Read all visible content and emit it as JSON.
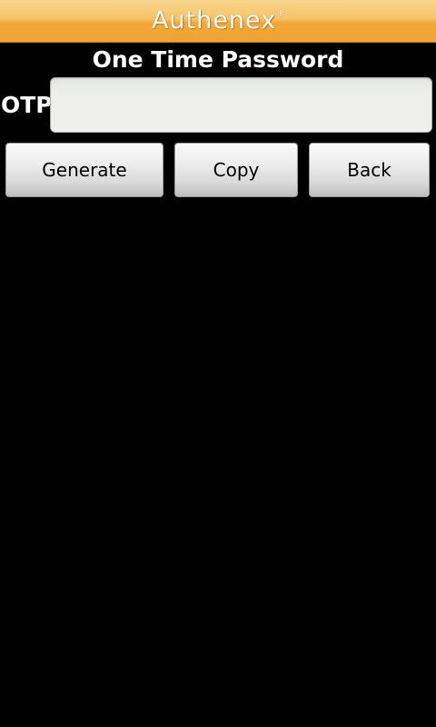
{
  "header": {
    "logo_text": "Authenex",
    "logo_mark": "®"
  },
  "page": {
    "title": "One Time Password"
  },
  "otp": {
    "label": "OTP",
    "value": "",
    "placeholder": ""
  },
  "buttons": {
    "generate_label": "Generate",
    "copy_label": "Copy",
    "back_label": "Back"
  },
  "colors": {
    "header_orange": "#f2a93a",
    "background": "#000000",
    "text": "#ffffff"
  }
}
